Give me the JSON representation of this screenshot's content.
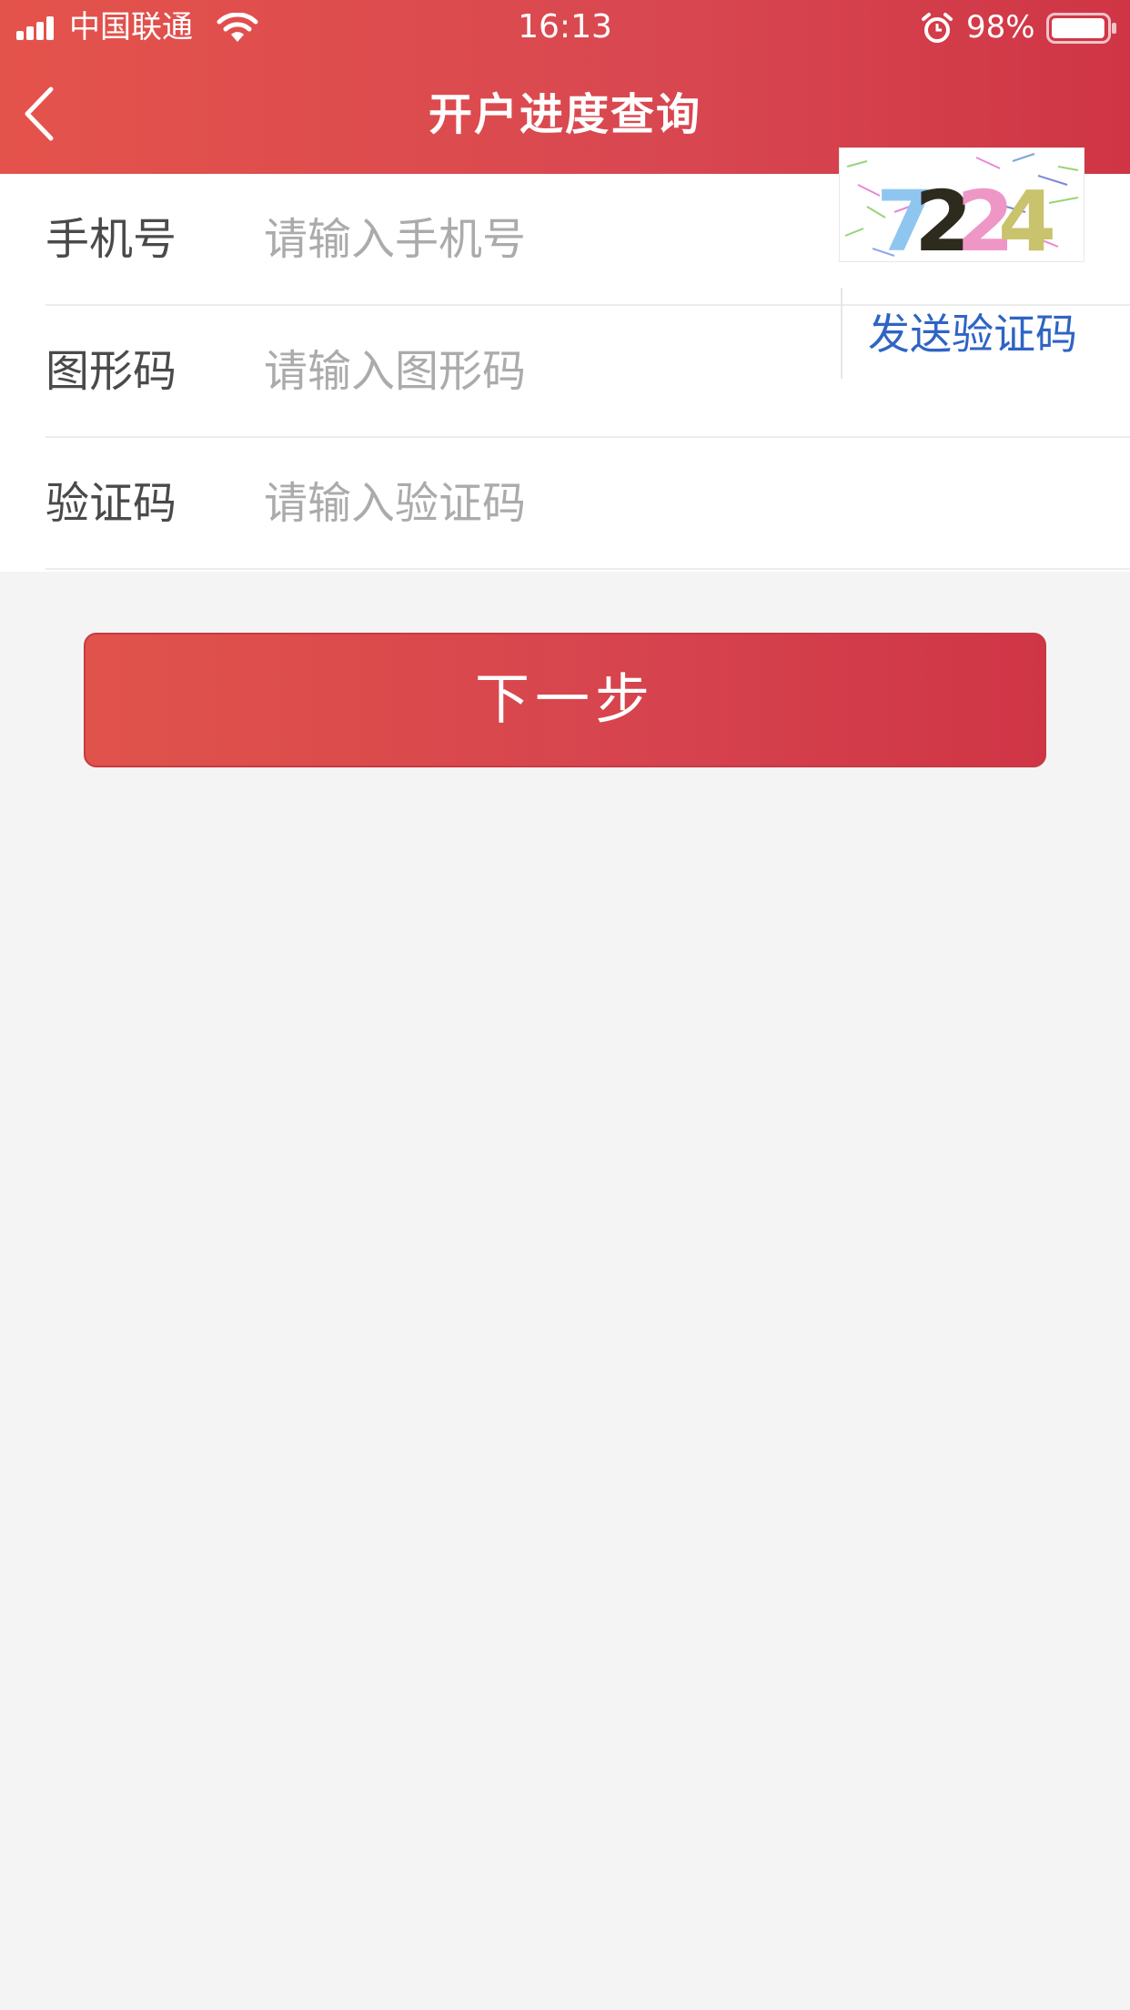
{
  "status_bar": {
    "carrier": "中国联通",
    "time": "16:13",
    "battery_percent": "98%",
    "battery_level": 0.98,
    "icons": [
      "signal-icon",
      "wifi-icon",
      "alarm-icon",
      "battery-icon"
    ]
  },
  "header": {
    "title": "开户进度查询",
    "back_icon": "chevron-left-icon"
  },
  "form": {
    "phone": {
      "label": "手机号",
      "placeholder": "请输入手机号",
      "value": ""
    },
    "captcha": {
      "label": "图形码",
      "placeholder": "请输入图形码",
      "value": "",
      "image_text": "7224"
    },
    "sms_code": {
      "label": "验证码",
      "placeholder": "请输入验证码",
      "value": "",
      "send_label": "发送验证码"
    }
  },
  "next_button": {
    "label": "下一步"
  },
  "colors": {
    "brand_red": "#d84750",
    "link_blue": "#2f64c4",
    "background": "#f4f4f4"
  }
}
